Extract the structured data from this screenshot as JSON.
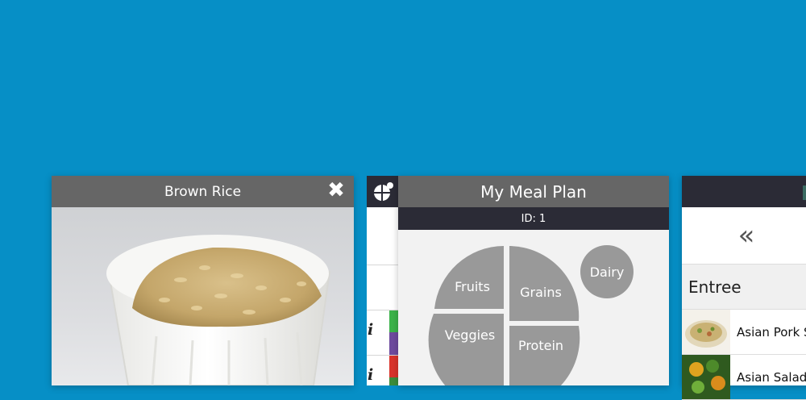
{
  "food_card": {
    "title": "Brown Rice",
    "close_icon": "close-icon"
  },
  "side_panel": {
    "icon": "pie-chart-icon",
    "rows": [
      {
        "info_icon": "info-icon",
        "strip_colors": [
          "#3cb34a",
          "#6e4b9e"
        ]
      },
      {
        "info_icon": "info-icon",
        "strip_colors": [
          "#d9342b",
          "#3c8d3c"
        ]
      }
    ]
  },
  "meal_plan": {
    "title": "My Meal Plan",
    "id_label": "ID: 1",
    "plate": {
      "fruits": "Fruits",
      "grains": "Grains",
      "veggies": "Veggies",
      "protein": "Protein",
      "dairy": "Dairy"
    }
  },
  "menu": {
    "back_icon": "double-chevron-left-icon",
    "back_label": "«",
    "section": "Entree",
    "items": [
      {
        "label": "Asian Pork S"
      },
      {
        "label": "Asian Salad"
      }
    ]
  },
  "colors": {
    "background": "#068fc6",
    "header_gray": "#666666",
    "header_dark": "#2b2b36",
    "plate_gray": "#999999"
  }
}
